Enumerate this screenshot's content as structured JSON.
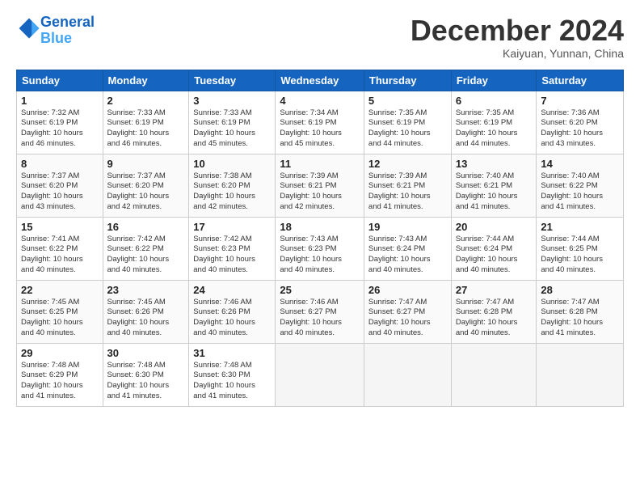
{
  "header": {
    "logo_line1": "General",
    "logo_line2": "Blue",
    "month": "December 2024",
    "location": "Kaiyuan, Yunnan, China"
  },
  "weekdays": [
    "Sunday",
    "Monday",
    "Tuesday",
    "Wednesday",
    "Thursday",
    "Friday",
    "Saturday"
  ],
  "weeks": [
    [
      {
        "day": "1",
        "info": "Sunrise: 7:32 AM\nSunset: 6:19 PM\nDaylight: 10 hours\nand 46 minutes."
      },
      {
        "day": "2",
        "info": "Sunrise: 7:33 AM\nSunset: 6:19 PM\nDaylight: 10 hours\nand 46 minutes."
      },
      {
        "day": "3",
        "info": "Sunrise: 7:33 AM\nSunset: 6:19 PM\nDaylight: 10 hours\nand 45 minutes."
      },
      {
        "day": "4",
        "info": "Sunrise: 7:34 AM\nSunset: 6:19 PM\nDaylight: 10 hours\nand 45 minutes."
      },
      {
        "day": "5",
        "info": "Sunrise: 7:35 AM\nSunset: 6:19 PM\nDaylight: 10 hours\nand 44 minutes."
      },
      {
        "day": "6",
        "info": "Sunrise: 7:35 AM\nSunset: 6:19 PM\nDaylight: 10 hours\nand 44 minutes."
      },
      {
        "day": "7",
        "info": "Sunrise: 7:36 AM\nSunset: 6:20 PM\nDaylight: 10 hours\nand 43 minutes."
      }
    ],
    [
      {
        "day": "8",
        "info": "Sunrise: 7:37 AM\nSunset: 6:20 PM\nDaylight: 10 hours\nand 43 minutes."
      },
      {
        "day": "9",
        "info": "Sunrise: 7:37 AM\nSunset: 6:20 PM\nDaylight: 10 hours\nand 42 minutes."
      },
      {
        "day": "10",
        "info": "Sunrise: 7:38 AM\nSunset: 6:20 PM\nDaylight: 10 hours\nand 42 minutes."
      },
      {
        "day": "11",
        "info": "Sunrise: 7:39 AM\nSunset: 6:21 PM\nDaylight: 10 hours\nand 42 minutes."
      },
      {
        "day": "12",
        "info": "Sunrise: 7:39 AM\nSunset: 6:21 PM\nDaylight: 10 hours\nand 41 minutes."
      },
      {
        "day": "13",
        "info": "Sunrise: 7:40 AM\nSunset: 6:21 PM\nDaylight: 10 hours\nand 41 minutes."
      },
      {
        "day": "14",
        "info": "Sunrise: 7:40 AM\nSunset: 6:22 PM\nDaylight: 10 hours\nand 41 minutes."
      }
    ],
    [
      {
        "day": "15",
        "info": "Sunrise: 7:41 AM\nSunset: 6:22 PM\nDaylight: 10 hours\nand 40 minutes."
      },
      {
        "day": "16",
        "info": "Sunrise: 7:42 AM\nSunset: 6:22 PM\nDaylight: 10 hours\nand 40 minutes."
      },
      {
        "day": "17",
        "info": "Sunrise: 7:42 AM\nSunset: 6:23 PM\nDaylight: 10 hours\nand 40 minutes."
      },
      {
        "day": "18",
        "info": "Sunrise: 7:43 AM\nSunset: 6:23 PM\nDaylight: 10 hours\nand 40 minutes."
      },
      {
        "day": "19",
        "info": "Sunrise: 7:43 AM\nSunset: 6:24 PM\nDaylight: 10 hours\nand 40 minutes."
      },
      {
        "day": "20",
        "info": "Sunrise: 7:44 AM\nSunset: 6:24 PM\nDaylight: 10 hours\nand 40 minutes."
      },
      {
        "day": "21",
        "info": "Sunrise: 7:44 AM\nSunset: 6:25 PM\nDaylight: 10 hours\nand 40 minutes."
      }
    ],
    [
      {
        "day": "22",
        "info": "Sunrise: 7:45 AM\nSunset: 6:25 PM\nDaylight: 10 hours\nand 40 minutes."
      },
      {
        "day": "23",
        "info": "Sunrise: 7:45 AM\nSunset: 6:26 PM\nDaylight: 10 hours\nand 40 minutes."
      },
      {
        "day": "24",
        "info": "Sunrise: 7:46 AM\nSunset: 6:26 PM\nDaylight: 10 hours\nand 40 minutes."
      },
      {
        "day": "25",
        "info": "Sunrise: 7:46 AM\nSunset: 6:27 PM\nDaylight: 10 hours\nand 40 minutes."
      },
      {
        "day": "26",
        "info": "Sunrise: 7:47 AM\nSunset: 6:27 PM\nDaylight: 10 hours\nand 40 minutes."
      },
      {
        "day": "27",
        "info": "Sunrise: 7:47 AM\nSunset: 6:28 PM\nDaylight: 10 hours\nand 40 minutes."
      },
      {
        "day": "28",
        "info": "Sunrise: 7:47 AM\nSunset: 6:28 PM\nDaylight: 10 hours\nand 41 minutes."
      }
    ],
    [
      {
        "day": "29",
        "info": "Sunrise: 7:48 AM\nSunset: 6:29 PM\nDaylight: 10 hours\nand 41 minutes."
      },
      {
        "day": "30",
        "info": "Sunrise: 7:48 AM\nSunset: 6:30 PM\nDaylight: 10 hours\nand 41 minutes."
      },
      {
        "day": "31",
        "info": "Sunrise: 7:48 AM\nSunset: 6:30 PM\nDaylight: 10 hours\nand 41 minutes."
      },
      null,
      null,
      null,
      null
    ]
  ]
}
